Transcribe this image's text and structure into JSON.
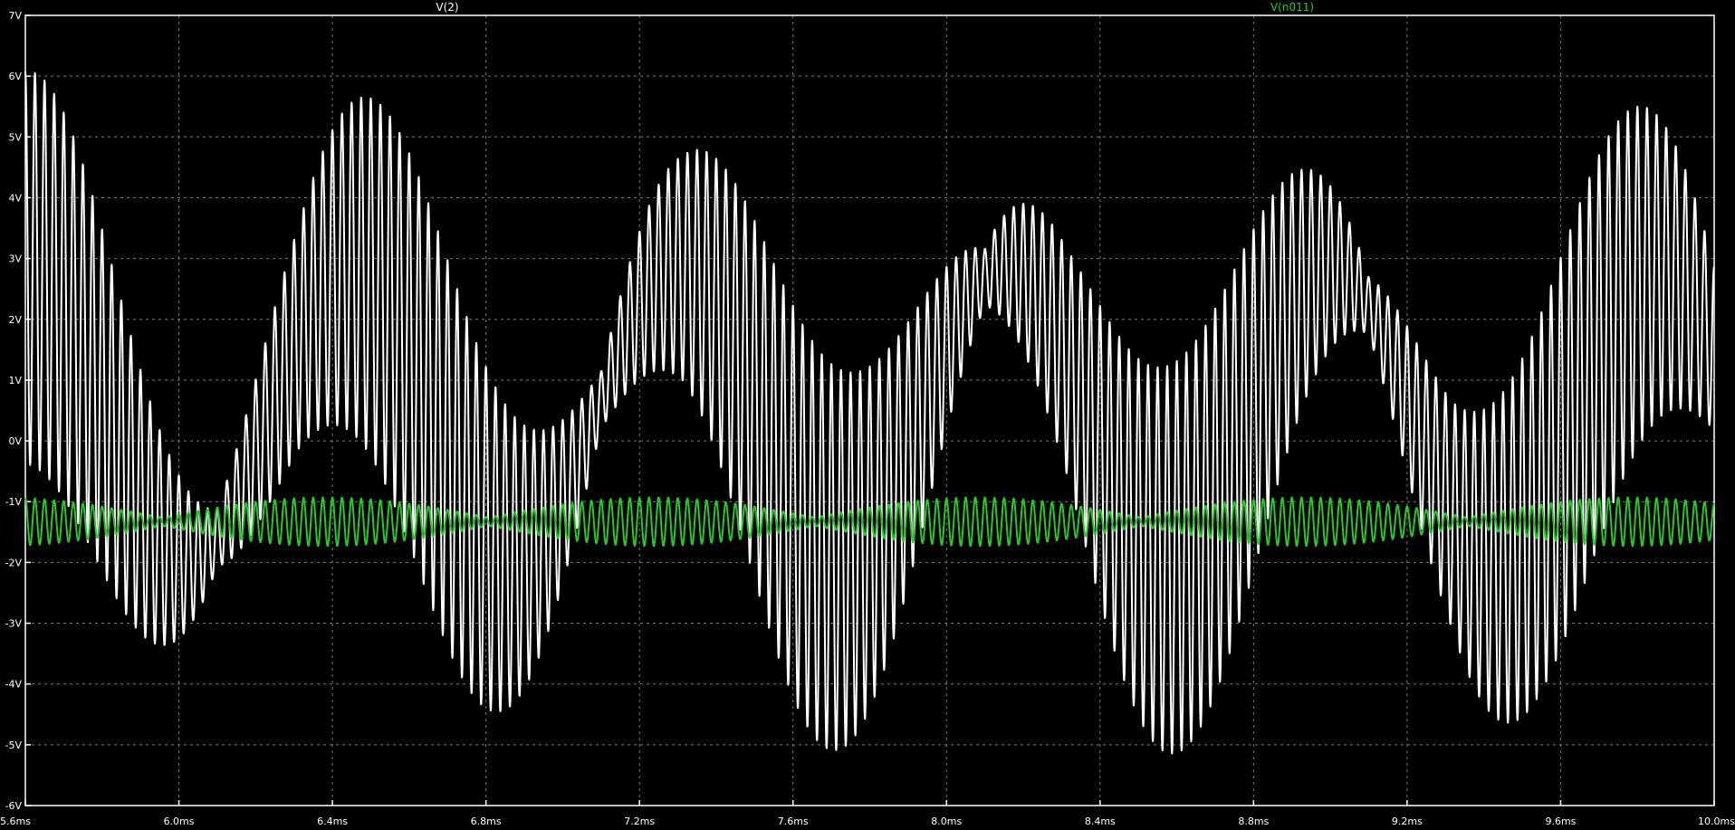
{
  "chart_data": {
    "type": "line",
    "x_unit": "ms",
    "y_unit": "V",
    "xlim": [
      5.6,
      10.0
    ],
    "ylim": [
      -6,
      7
    ],
    "x_ticks": [
      "5.6ms",
      "6.0ms",
      "6.4ms",
      "6.8ms",
      "7.2ms",
      "7.6ms",
      "8.0ms",
      "8.4ms",
      "8.8ms",
      "9.2ms",
      "9.6ms",
      "10.0ms"
    ],
    "y_ticks": [
      "7V",
      "6V",
      "5V",
      "4V",
      "3V",
      "2V",
      "1V",
      "0V",
      "-1V",
      "-2V",
      "-3V",
      "-4V",
      "-5V",
      "-6V"
    ],
    "grid": true,
    "legend_position": "top",
    "series": [
      {
        "name": "V(2)",
        "color": "#ffffff",
        "description_params": {
          "carrier_frequency_khz": 40,
          "envelope_frequency_khz": 1.0,
          "envelope_phase_ms": 5.6,
          "low_freq_amplitude_v": 2.4,
          "peak_max_v": 5.6,
          "trough_min_v": -4.8
        }
      },
      {
        "name": "V(n011)",
        "color": "#22cc22",
        "description_params": {
          "carrier_frequency_khz": 40,
          "center_v": -1.33,
          "max_v": -0.92,
          "min_v": -1.72
        }
      }
    ]
  }
}
